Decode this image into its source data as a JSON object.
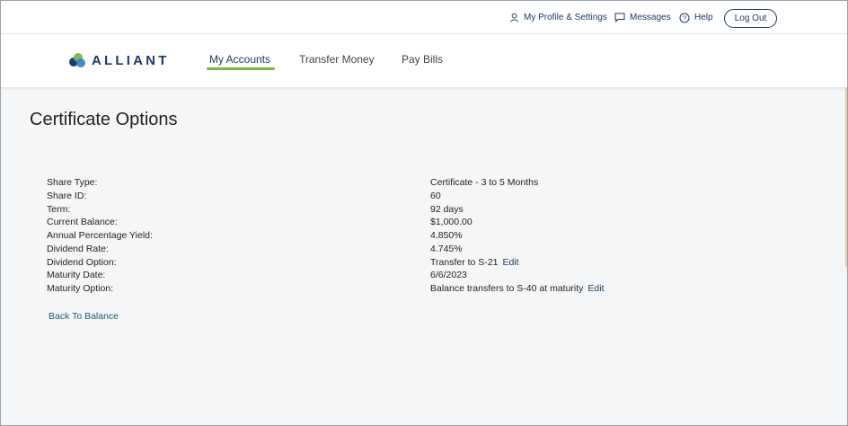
{
  "utility": {
    "profile_label": "My Profile & Settings",
    "messages_label": "Messages",
    "help_label": "Help",
    "logout_label": "Log Out"
  },
  "logo": {
    "text": "ALLIANT",
    "colors": [
      "#1c3a66",
      "#2f7fc1",
      "#7ab648"
    ]
  },
  "nav": {
    "items": [
      {
        "label": "My Accounts",
        "active": true
      },
      {
        "label": "Transfer Money",
        "active": false
      },
      {
        "label": "Pay Bills",
        "active": false
      }
    ],
    "accent": "#7ab648"
  },
  "page": {
    "title": "Certificate Options"
  },
  "details": [
    {
      "label": "Share Type:",
      "value": "Certificate - 3 to 5 Months"
    },
    {
      "label": "Share ID:",
      "value": "60"
    },
    {
      "label": "Term:",
      "value": "92 days"
    },
    {
      "label": "Current Balance:",
      "value": "$1,000.00"
    },
    {
      "label": "Annual Percentage Yield:",
      "value": "4.850%"
    },
    {
      "label": "Dividend Rate:",
      "value": "4.745%"
    },
    {
      "label": "Dividend Option:",
      "value": "Transfer to S-21",
      "edit": "Edit"
    },
    {
      "label": "Maturity Date:",
      "value": "6/6/2023"
    },
    {
      "label": "Maturity Option:",
      "value": "Balance transfers to S-40 at maturity",
      "edit": "Edit"
    }
  ],
  "back_link": "Back To Balance"
}
